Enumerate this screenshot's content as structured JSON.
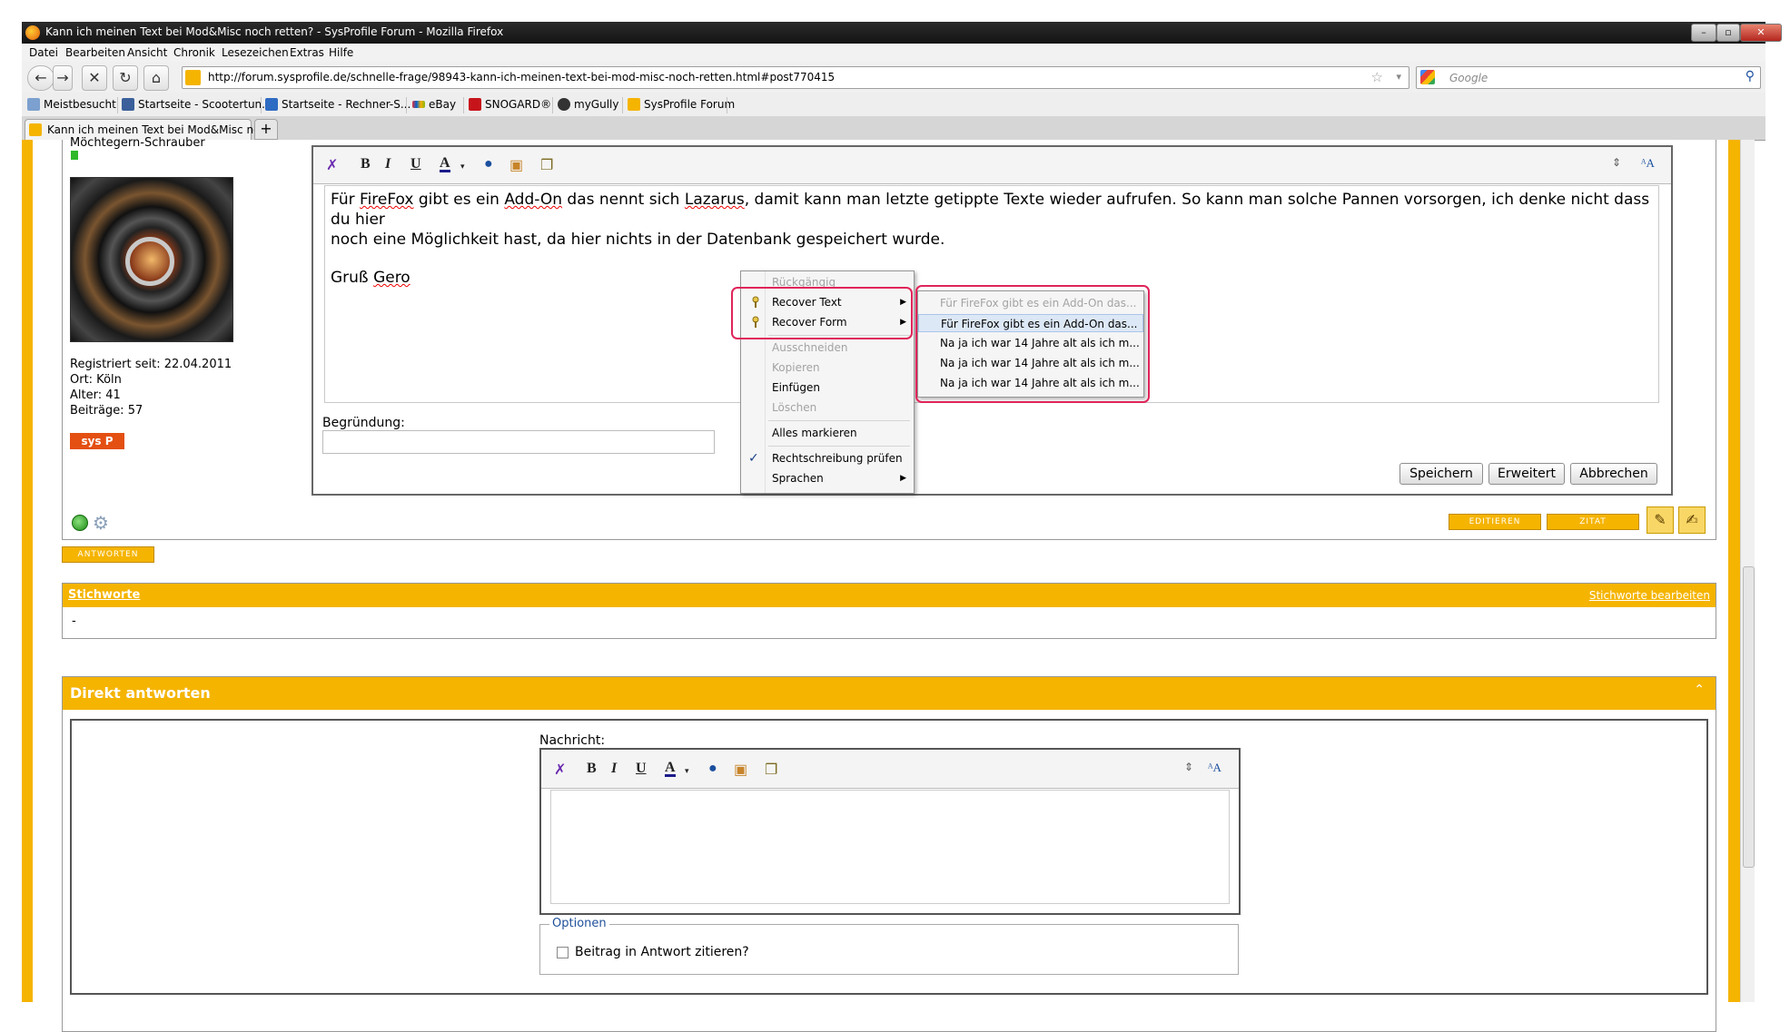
{
  "window": {
    "title": "Kann ich meinen Text bei Mod&Misc noch retten? - SysProfile Forum - Mozilla Firefox",
    "controls": [
      "–",
      "▫",
      "✕"
    ]
  },
  "menubar": [
    "Datei",
    "Bearbeiten",
    "Ansicht",
    "Chronik",
    "Lesezeichen",
    "Extras",
    "Hilfe"
  ],
  "navbar": {
    "url": "http://forum.sysprofile.de/schnelle-frage/98943-kann-ich-meinen-text-bei-mod-misc-noch-retten.html#post770415",
    "search_placeholder": "Google"
  },
  "bookmarks": [
    "Meistbesucht",
    "Startseite - Scootertun...",
    "Startseite - Rechner-S...",
    "eBay",
    "SNOGARD®",
    "myGully",
    "SysProfile Forum"
  ],
  "tab": {
    "label": "Kann ich meinen Text bei Mod&Misc no...",
    "new_tab": "+"
  },
  "user": {
    "rank": "Möchtegern-Schrauber",
    "registered": "Registriert seit: 22.04.2011",
    "location": "Ort: Köln",
    "age": "Alter: 41",
    "posts": "Beiträge: 57",
    "badge": "sys P"
  },
  "editor": {
    "text_line1_pre": "Für ",
    "text_firefox": "FireFox",
    "text_line1_mid": " gibt es ein ",
    "text_addon": "Add-On",
    "text_line1_mid2": " das nennt sich ",
    "text_lazarus": "Lazarus",
    "text_line1_post": ", damit kann man letzte getippte Texte wieder aufrufen. So kann man solche Pannen vorsorgen, ich denke nicht dass du hier",
    "text_line2": "noch eine Möglichkeit hast, da hier nichts in der Datenbank gespeichert wurde.",
    "greeting_pre": "Gruß ",
    "greeting_name": "Gero",
    "reason_label": "Begründung:",
    "save": "Speichern",
    "advanced": "Erweitert",
    "cancel": "Abbrechen"
  },
  "context_menu": {
    "undo": "Rückgängig",
    "recover_text": "Recover Text",
    "recover_form": "Recover Form",
    "cut": "Ausschneiden",
    "copy": "Kopieren",
    "paste": "Einfügen",
    "delete": "Löschen",
    "select_all": "Alles markieren",
    "spellcheck": "Rechtschreibung prüfen",
    "languages": "Sprachen"
  },
  "submenu": [
    "Für FireFox gibt es ein Add-On das...",
    "Für FireFox gibt es ein Add-On das...",
    "Na ja ich war 14 Jahre alt als ich m...",
    "Na ja ich war 14 Jahre alt als ich m...",
    "Na ja ich war 14 Jahre alt als ich m..."
  ],
  "post_buttons": {
    "edit": "EDITIEREN",
    "quote": "ZITAT",
    "reply": "ANTWORTEN"
  },
  "tags": {
    "title": "Stichworte",
    "edit": "Stichworte bearbeiten",
    "value": "-"
  },
  "direct_reply": {
    "title": "Direkt antworten",
    "collapse": "⌃",
    "message_label": "Nachricht:",
    "options_legend": "Optionen",
    "quote_checkbox": "Beitrag in Antwort zitieren?"
  },
  "colors": {
    "accent": "#f5b400",
    "highlight": "#e0245a"
  }
}
